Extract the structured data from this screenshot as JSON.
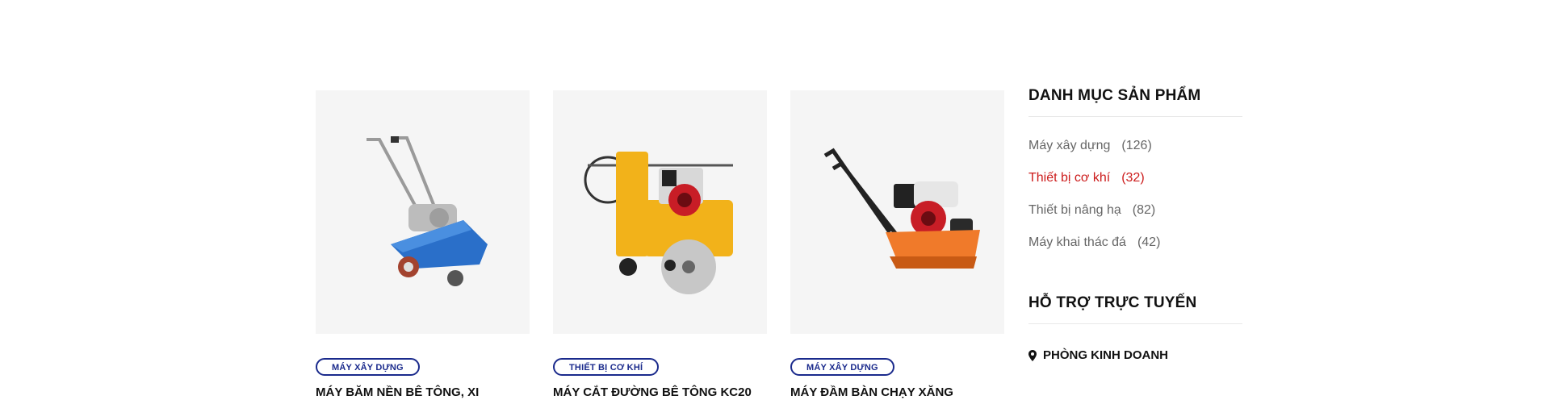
{
  "products": [
    {
      "category": "MÁY XÂY DỰNG",
      "title": "MÁY BĂM NỀN BÊ TÔNG, XI",
      "image_icon": "concrete-scarifier-machine"
    },
    {
      "category": "THIẾT BỊ CƠ KHÍ",
      "title": "MÁY CẮT ĐƯỜNG BÊ TÔNG KC20",
      "image_icon": "concrete-road-cutter-machine"
    },
    {
      "category": "MÁY XÂY DỰNG",
      "title": "MÁY ĐẦM BÀN CHẠY XĂNG",
      "image_icon": "plate-compactor-machine"
    }
  ],
  "sidebar": {
    "categories_title": "DANH MỤC SẢN PHẨM",
    "categories": [
      {
        "label": "Máy xây dựng",
        "count": "(126)"
      },
      {
        "label": "Thiết bị cơ khí",
        "count": "(32)",
        "active": true
      },
      {
        "label": "Thiết bị nâng hạ",
        "count": "(82)"
      },
      {
        "label": "Máy khai thác đá",
        "count": "(42)"
      }
    ],
    "support_title": "HỖ TRỢ TRỰC TUYẾN",
    "support_items": [
      {
        "label": "PHÒNG KINH DOANH",
        "icon": "map-pin-icon"
      }
    ]
  },
  "colors": {
    "accent": "#1a2a8c",
    "active": "#cc1b1b",
    "thumb_bg": "#f5f5f5"
  }
}
